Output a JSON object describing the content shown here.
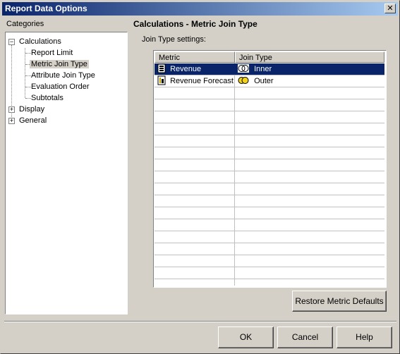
{
  "window": {
    "title": "Report Data Options",
    "close_glyph": "✕"
  },
  "categories": {
    "label": "Categories",
    "tree": [
      {
        "label": "Calculations",
        "expanded": true,
        "children": [
          "Report Limit",
          "Metric Join Type",
          "Attribute Join Type",
          "Evaluation Order",
          "Subtotals"
        ]
      },
      {
        "label": "Display",
        "expanded": false
      },
      {
        "label": "General",
        "expanded": false
      }
    ],
    "selected": "Metric Join Type"
  },
  "panel": {
    "heading": "Calculations - Metric Join Type",
    "subheading": "Join Type settings:",
    "grid": {
      "columns": [
        "Metric",
        "Join Type"
      ],
      "rows": [
        {
          "metric": "Revenue",
          "join_type": "Inner",
          "selected": true,
          "metric_icon": "metric-icon",
          "join_icon": "inner-join-icon"
        },
        {
          "metric": "Revenue Forecast",
          "join_type": "Outer",
          "selected": false,
          "metric_icon": "metric-icon",
          "join_icon": "outer-join-icon"
        }
      ]
    },
    "restore_button": "Restore Metric Defaults"
  },
  "footer": {
    "ok": "OK",
    "cancel": "Cancel",
    "help": "Help"
  },
  "colors": {
    "titlebar": "#0a246a",
    "selection": "#0a246a",
    "face": "#d4d0c8"
  }
}
